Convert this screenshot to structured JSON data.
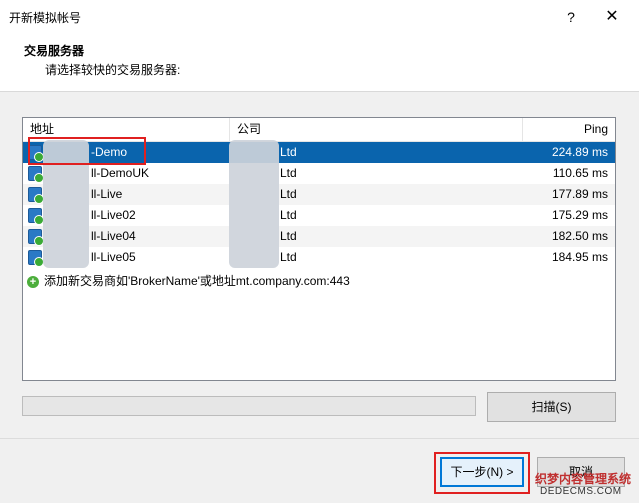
{
  "window": {
    "title": "开新模拟帐号",
    "help": "?",
    "close": "✕"
  },
  "header": {
    "title": "交易服务器",
    "subtitle": "请选择较快的交易服务器:"
  },
  "list": {
    "columns": {
      "address": "地址",
      "company": "公司",
      "ping": "Ping"
    },
    "rows": [
      {
        "name": "-Demo",
        "company": "Ltd",
        "ping": "224.89 ms",
        "icon": "server-demo-icon"
      },
      {
        "name": "ll-DemoUK",
        "company": "Ltd",
        "ping": "110.65 ms",
        "icon": "server-demo-icon"
      },
      {
        "name": "ll-Live",
        "company": "Ltd",
        "ping": "177.89 ms",
        "icon": "server-live-icon"
      },
      {
        "name": "ll-Live02",
        "company": "Ltd",
        "ping": "175.29 ms",
        "icon": "server-demo-icon"
      },
      {
        "name": "ll-Live04",
        "company": "Ltd",
        "ping": "182.50 ms",
        "icon": "server-live-icon"
      },
      {
        "name": "ll-Live05",
        "company": "Ltd",
        "ping": "184.95 ms",
        "icon": "server-live-icon"
      }
    ],
    "add_text": "添加新交易商如'BrokerName'或地址mt.company.com:443"
  },
  "buttons": {
    "scan": "扫描(S)",
    "next": "下一步(N) >",
    "cancel": "取消"
  },
  "watermark": {
    "line1": "织梦内容管理系统",
    "line2": "DEDECMS.COM"
  },
  "colors": {
    "selection": "#0a64ad",
    "annotation": "#e02020",
    "accent": "#0078d7"
  }
}
